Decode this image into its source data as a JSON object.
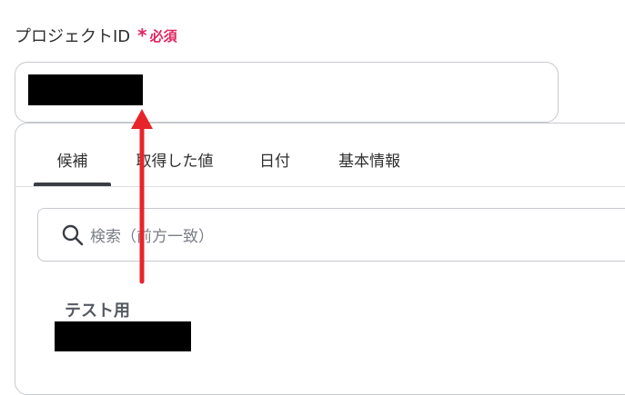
{
  "field": {
    "label": "プロジェクトID",
    "required_mark": "*",
    "required_text": "必須"
  },
  "tabs": [
    {
      "label": "候補",
      "active": true
    },
    {
      "label": "取得した値",
      "active": false
    },
    {
      "label": "日付",
      "active": false
    },
    {
      "label": "基本情報",
      "active": false
    }
  ],
  "search": {
    "placeholder": "検索（前方一致）"
  },
  "candidates": {
    "group_title": "テスト用"
  },
  "colors": {
    "required": "#e0245e",
    "annotation_arrow": "#e8242b",
    "redaction": "#000000"
  }
}
